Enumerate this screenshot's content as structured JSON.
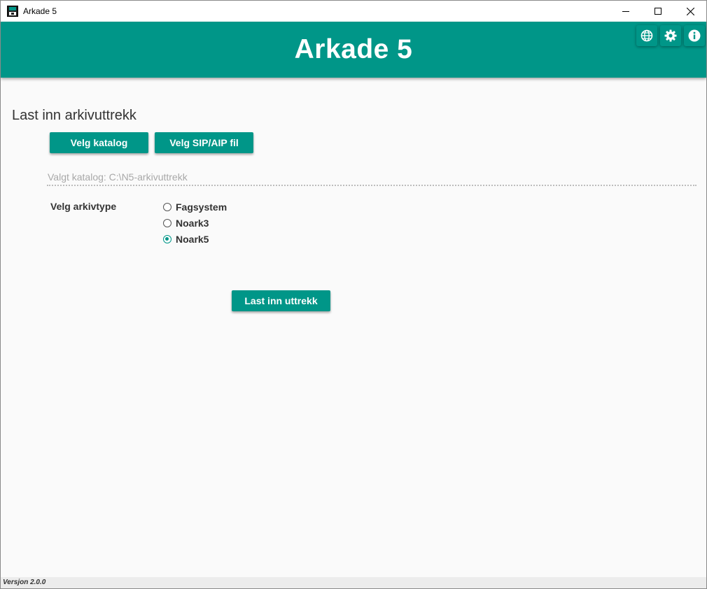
{
  "window": {
    "title": "Arkade 5"
  },
  "header": {
    "title": "Arkade 5",
    "icons": [
      "globe-icon",
      "gear-icon",
      "info-icon"
    ]
  },
  "main": {
    "section_title": "Last inn arkivuttrekk",
    "choose_folder_label": "Velg katalog",
    "choose_file_label": "Velg SIP/AIP fil",
    "selected_path": "Valgt katalog: C:\\N5-arkivuttrekk",
    "archive_type_label": "Velg arkivtype",
    "archive_types": [
      {
        "label": "Fagsystem",
        "checked": false
      },
      {
        "label": "Noark3",
        "checked": false
      },
      {
        "label": "Noark5",
        "checked": true
      }
    ],
    "load_button_label": "Last inn uttrekk"
  },
  "statusbar": {
    "version": "Versjon 2.0.0"
  },
  "colors": {
    "accent": "#009688",
    "background": "#fafafa"
  }
}
